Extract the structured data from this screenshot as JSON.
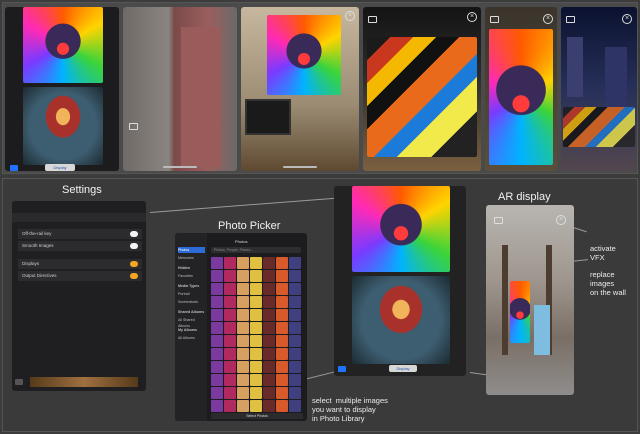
{
  "labels": {
    "settings": "Settings",
    "photo_picker": "Photo Picker",
    "ar_display": "AR display",
    "activate_vfx": "activate\nVFX",
    "replace_images": "replace\nimages\non the wall",
    "select_note": "select  multiple images\nyou want to display\nin Photo Library"
  },
  "settings_panel": {
    "rows": [
      "Off-the-rail key",
      "Smooth Images",
      "Displays",
      "Output Directives"
    ],
    "toggle_colors": [
      "#f2f2f2",
      "#f2f2f2",
      "#f5a623",
      "#f5a623"
    ]
  },
  "picker": {
    "title": "Photos",
    "search_placeholder": "Photos, People, Places...",
    "sidebar": [
      "Photos",
      "Memories",
      "Hidden",
      "Favorites",
      "Media Types",
      "Portrait",
      "Screenshots",
      "Shared Albums",
      "All Shared Albums",
      "My Albums",
      "All Albums"
    ],
    "bottom": "Select Photos"
  },
  "main_ipad": {
    "display_label": "Display"
  },
  "top_strip": {
    "display_label": "Display"
  },
  "colors": {
    "accent": "#1e73ff",
    "toggle_on": "#f5a623"
  }
}
